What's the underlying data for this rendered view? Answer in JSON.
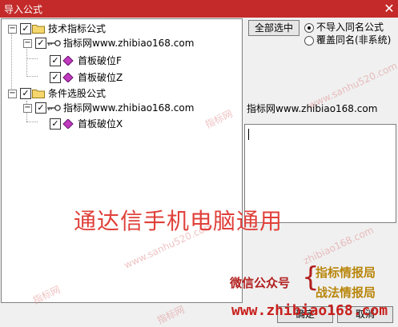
{
  "window": {
    "title": "导入公式",
    "close_glyph": "✕"
  },
  "tree": {
    "expander_collapse": "−",
    "check_mark": "✓",
    "nodes": [
      {
        "label": "技术指标公式",
        "checked": true
      },
      {
        "label": "指标网www.zhibiao168.com",
        "checked": true
      },
      {
        "label": "首板破位F",
        "checked": true
      },
      {
        "label": "首板破位Z",
        "checked": true
      },
      {
        "label": "条件选股公式",
        "checked": true
      },
      {
        "label": "指标网www.zhibiao168.com",
        "checked": true
      },
      {
        "label": "首板破位X",
        "checked": true
      }
    ]
  },
  "buttons": {
    "select_all": "全部选中",
    "ok": "确定",
    "cancel": "取消"
  },
  "options": {
    "no_import_same": "不导入同名公式",
    "overwrite_same": "覆盖同名(非系统)",
    "selected": "no_import_same"
  },
  "info": {
    "text": "指标网www.zhibiao168.com"
  },
  "overlay": {
    "main": "通达信手机电脑通用",
    "wechat": "微信公众号",
    "brace": "{",
    "tag1": "指标情报局",
    "tag2": "战法情报局",
    "url": "www.zhibiao168.com"
  },
  "watermarks": [
    "www.sanhu520.com",
    "指标网",
    "www.sanhu520.com",
    "指标网",
    "zhibiao168.com",
    "指标网"
  ],
  "colors": {
    "titlebar": "#c42a2a",
    "accent_red": "#e0403a",
    "tag_gold": "#b8860b"
  }
}
